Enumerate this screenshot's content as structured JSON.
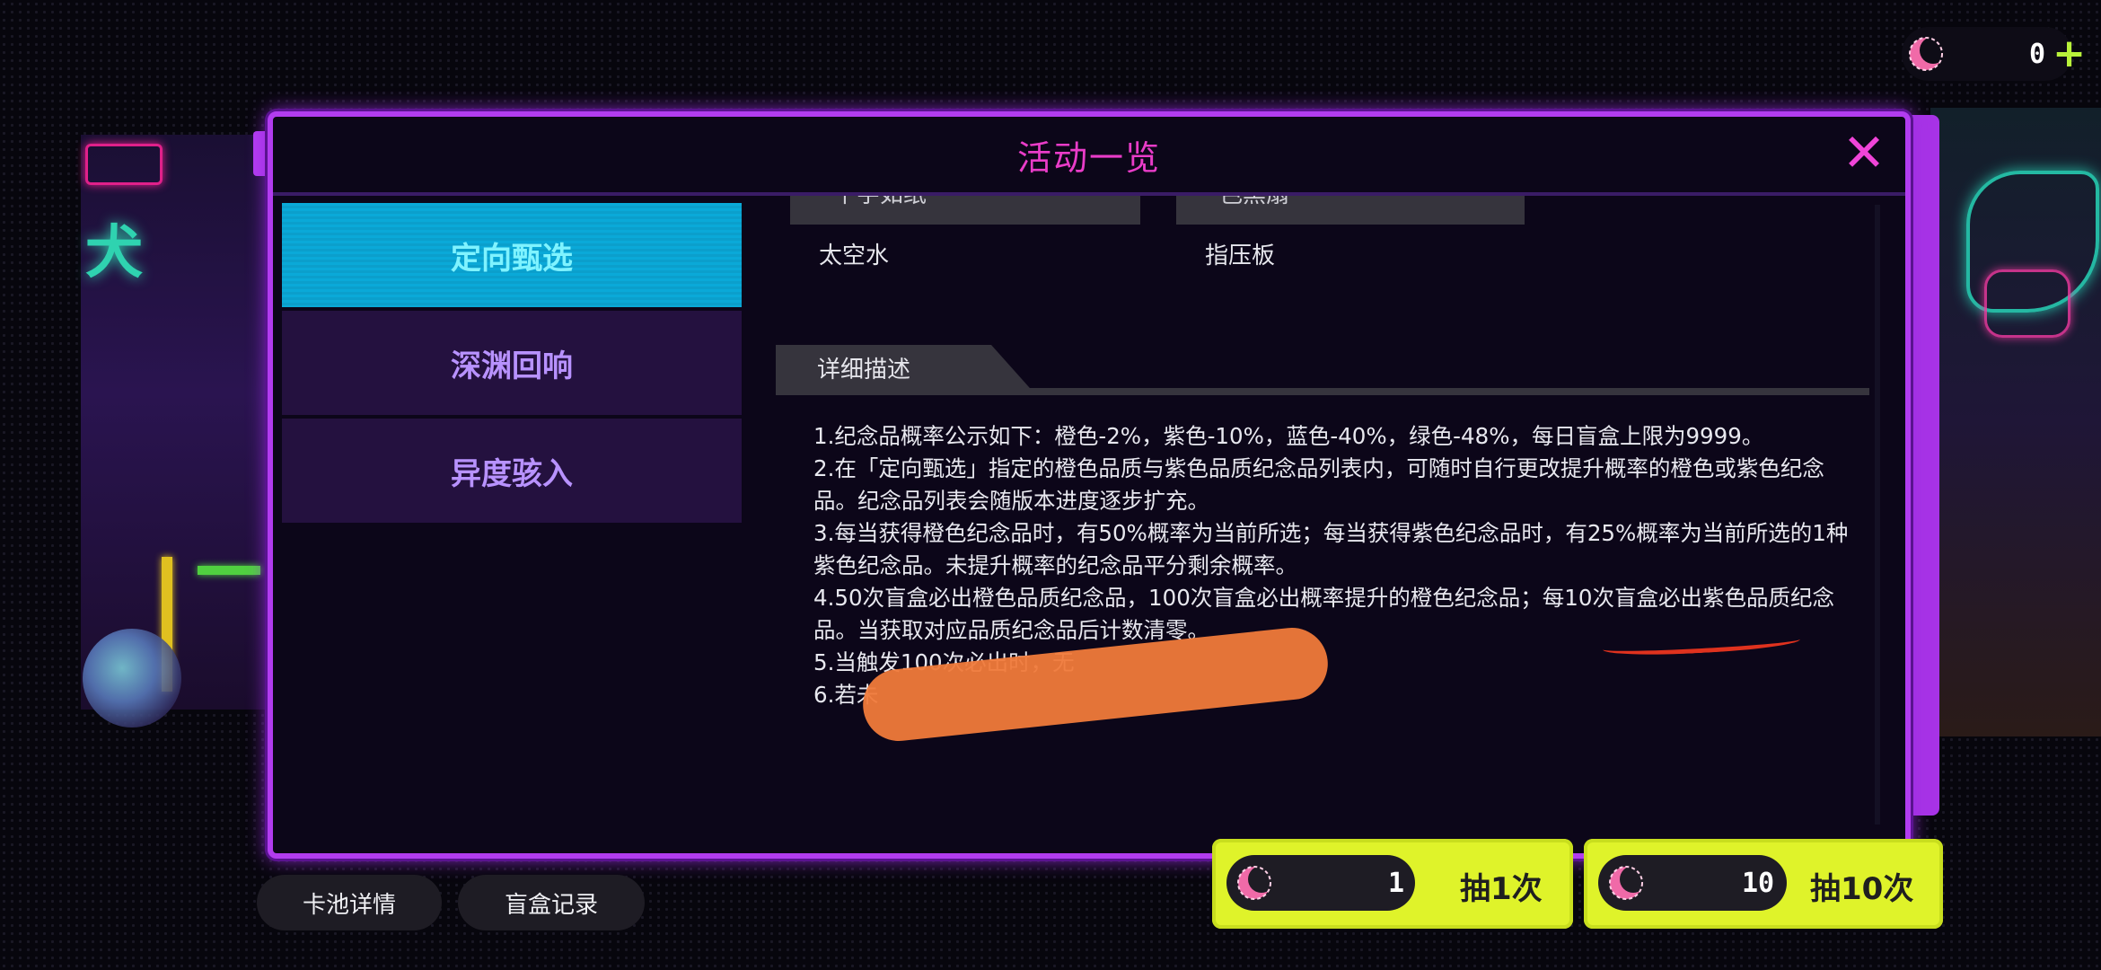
{
  "currency": {
    "amount": "0",
    "icon": "moon-crescent-icon",
    "add_icon": "plus-icon"
  },
  "modal": {
    "title": "活动一览",
    "close_icon": "close-icon",
    "menu": [
      {
        "label": "定向甄选",
        "active": true
      },
      {
        "label": "深渊回响",
        "active": false
      },
      {
        "label": "异度骇入",
        "active": false
      }
    ],
    "grid": {
      "left_header": "千字如纸",
      "right_header": "色黑扇",
      "left_item": "太空水",
      "right_item": "指压板"
    },
    "detail_tab": "详细描述",
    "description": [
      "1.纪念品概率公示如下：橙色-2%，紫色-10%，蓝色-40%，绿色-48%，每日盲盒上限为9999。",
      "2.在「定向甄选」指定的橙色品质与紫色品质纪念品列表内，可随时自行更改提升概率的橙色或紫色纪念品。纪念品列表会随版本进度逐步扩充。",
      "3.每当获得橙色纪念品时，有50%概率为当前所选；每当获得紫色纪念品时，有25%概率为当前所选的1种紫色纪念品。未提升概率的纪念品平分剩余概率。",
      "4.50次盲盒必出橙色品质纪念品，100次盲盒必出概率提升的橙色纪念品；每10次盲盒必出紫色品质纪念品。当获取对应品质纪念品后计数清零。",
      "5.当触发100次必出时，无",
      "6.若未"
    ]
  },
  "bottom": {
    "pool_details": "卡池详情",
    "box_record": "盲盒记录",
    "draw1": {
      "count": "1",
      "label": "抽1次"
    },
    "draw10": {
      "count": "10",
      "label": "抽10次"
    }
  },
  "colors": {
    "accent": "#b23cf0",
    "title": "#e93cc8",
    "active_tab": "#0aa9d8",
    "draw_button": "#dff32a"
  }
}
